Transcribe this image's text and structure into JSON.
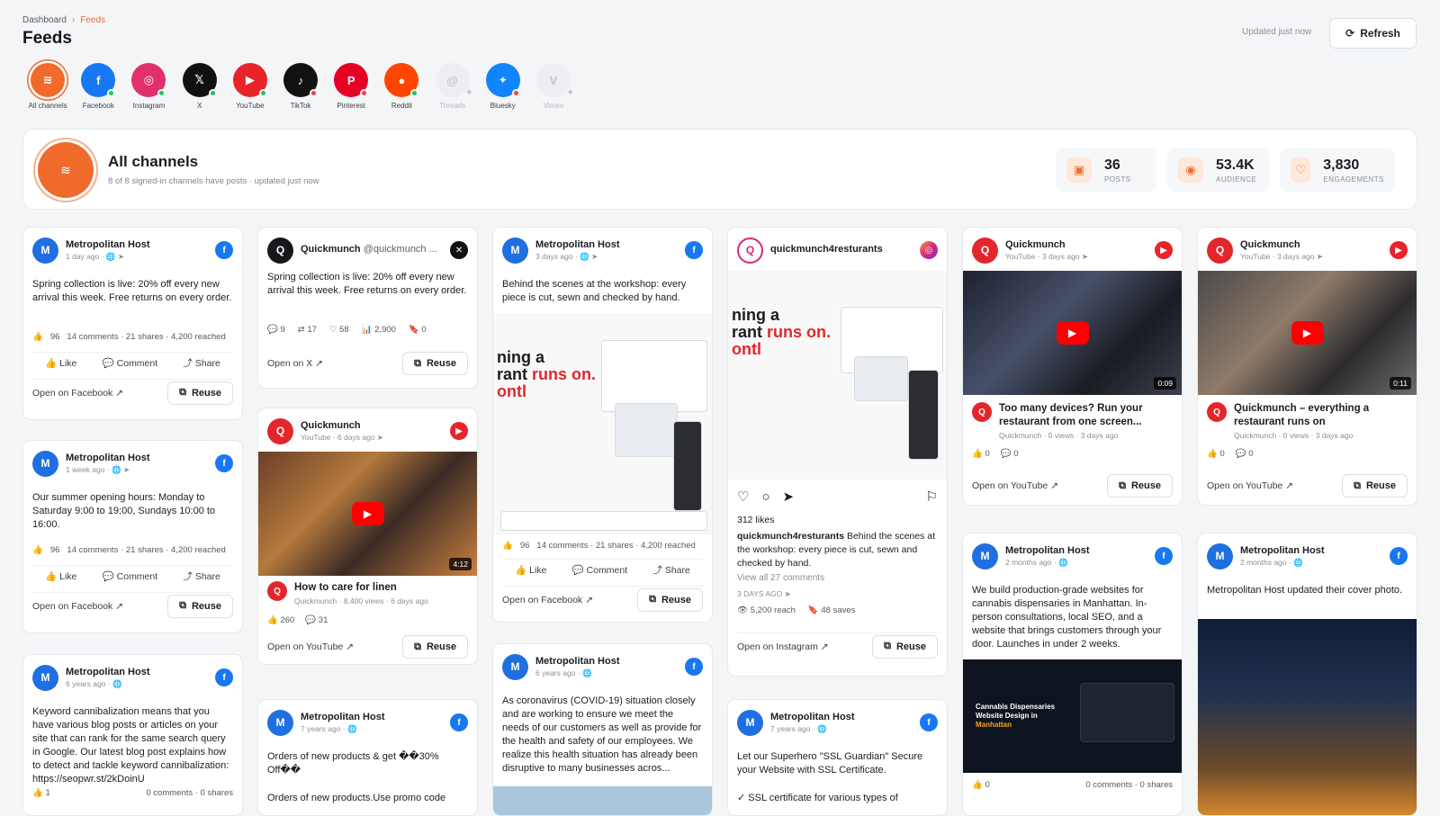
{
  "breadcrumb": {
    "root": "Dashboard",
    "current": "Feeds"
  },
  "page_title": "Feeds",
  "updated_text": "Updated just now",
  "refresh_label": "Refresh",
  "colors": {
    "accent": "#ef6c2d",
    "facebook": "#1877f2",
    "youtube": "#e8232a"
  },
  "channels": [
    {
      "label": "All channels",
      "icon": "layers-icon"
    },
    {
      "label": "Facebook",
      "icon": "facebook-icon",
      "glyph": "f"
    },
    {
      "label": "Instagram",
      "icon": "instagram-icon",
      "glyph": "◎"
    },
    {
      "label": "X",
      "icon": "x-icon",
      "glyph": "𝕏"
    },
    {
      "label": "YouTube",
      "icon": "youtube-icon",
      "glyph": "▶"
    },
    {
      "label": "TikTok",
      "icon": "tiktok-icon",
      "glyph": "♪"
    },
    {
      "label": "Pinterest",
      "icon": "pinterest-icon",
      "glyph": "P"
    },
    {
      "label": "Reddit",
      "icon": "reddit-icon",
      "glyph": "●"
    },
    {
      "label": "Threads",
      "icon": "threads-icon",
      "glyph": "@"
    },
    {
      "label": "Bluesky",
      "icon": "bluesky-icon",
      "glyph": "🦋"
    },
    {
      "label": "Vimeo",
      "icon": "vimeo-icon",
      "glyph": "V"
    }
  ],
  "banner": {
    "title": "All channels",
    "subtitle": "8 of 8 signed-in channels have posts",
    "updated": "· updated just now",
    "stats": [
      {
        "value": "36",
        "caption": "POSTS",
        "icon": "image-icon"
      },
      {
        "value": "53.4K",
        "caption": "AUDIENCE",
        "icon": "eye-icon"
      },
      {
        "value": "3,830",
        "caption": "ENGAGEMENTS",
        "icon": "heart-icon"
      }
    ]
  },
  "common": {
    "like": "Like",
    "comment": "Comment",
    "share": "Share",
    "reuse": "Reuse",
    "open_facebook": "Open on Facebook",
    "open_x": "Open on X",
    "open_youtube": "Open on YouTube",
    "open_instagram": "Open on Instagram"
  },
  "posts": {
    "c1a": {
      "name": "Metropolitan Host",
      "time": "1 day ago ·",
      "text": "Spring collection is live: 20% off every new arrival this week. Free returns on every order.",
      "likes": "96",
      "summary": "14 comments · 21 shares · 4,200 reached"
    },
    "c1b": {
      "name": "Metropolitan Host",
      "time": "1 week ago ·",
      "text": "Our summer opening hours: Monday to Saturday 9:00 to 19:00, Sundays 10:00 to 16:00.",
      "likes": "96",
      "summary": "14 comments · 21 shares · 4,200 reached"
    },
    "c1c": {
      "name": "Metropolitan Host",
      "time": "6 years ago ·",
      "text": "Keyword cannibalization means that you have various blog posts or articles on your site that can rank for the same search query in Google. Our latest blog post explains how to detect and tackle keyword cannibalization: https://seopwr.st/2kDoinU",
      "likes": "1",
      "summary": "0 comments · 0 shares"
    },
    "c2a": {
      "name": "Quickmunch",
      "handle": "@quickmunch ...",
      "text": "Spring collection is live: 20% off every new arrival this week. Free returns on every order.",
      "replies": "9",
      "reposts": "17",
      "likes": "58",
      "views": "2,900",
      "bookmarks": "0"
    },
    "c2b": {
      "name": "Quickmunch",
      "time": "YouTube · 6 days ago",
      "duration": "4:12",
      "title": "How to care for linen",
      "meta": "Quickmunch · 8,400 views · 6 days ago",
      "likes": "260",
      "comments": "31"
    },
    "c2c": {
      "name": "Metropolitan Host",
      "time": "7 years ago ·",
      "text": "Orders of new products & get ��30% Off��",
      "text2": "Orders of new products.Use promo code"
    },
    "c3a": {
      "name": "Metropolitan Host",
      "time": "3 days ago ·",
      "text": "Behind the scenes at the workshop: every piece is cut, sewn and checked by hand.",
      "likes": "96",
      "summary": "14 comments · 21 shares · 4,200 reached",
      "promo_line1": "ning a",
      "promo_line2": "rant ",
      "promo_hl": "runs on.",
      "promo_line3": "ontl"
    },
    "c3b": {
      "name": "Metropolitan Host",
      "time": "6 years ago ·",
      "text": "As coronavirus (COVID-19) situation closely and are working to ensure we meet the needs of our customers as well as provide for the health and safety of our employees. We realize this health situation has already been disruptive to many businesses acros..."
    },
    "c4a": {
      "name": "quickmunch4resturants",
      "likes_text": "312 likes",
      "caption_user": "quickmunch4resturants",
      "caption": " Behind the scenes at the workshop: every piece is cut, sewn and checked by hand.",
      "view_comments": "View all 27 comments",
      "date": "3 DAYS AGO",
      "reach": "5,200 reach",
      "saves": "48 saves",
      "promo_line1": "ning a",
      "promo_line2": "rant ",
      "promo_hl": "runs on.",
      "promo_line3": "ontl"
    },
    "c4b": {
      "name": "Metropolitan Host",
      "time": "7 years ago ·",
      "text": "Let our Superhero \"SSL Guardian\" Secure your Website with SSL Certificate.",
      "text2": "✓ SSL certificate for various types of"
    },
    "c5a": {
      "name": "Quickmunch",
      "time": "YouTube · 3 days ago",
      "duration": "0:09",
      "title": "Too many devices? Run your restaurant from one screen...",
      "meta": "Quickmunch · 0 views · 3 days ago",
      "likes": "0",
      "comments": "0"
    },
    "c5b": {
      "name": "Metropolitan Host",
      "time": "2 months ago ·",
      "text": "We build production-grade websites for cannabis dispensaries in Manhattan. In-person consultations, local SEO, and a website that brings customers through your door. Launches in under 2 weeks.",
      "likes": "0",
      "summary": "0 comments · 0 shares",
      "img_title": "Cannabis Dispensaries Website Design in ",
      "img_hl": "Manhattan"
    },
    "c6a": {
      "name": "Quickmunch",
      "time": "YouTube · 3 days ago",
      "duration": "0:11",
      "title": "Quickmunch – everything a restaurant runs on",
      "meta": "Quickmunch · 0 views · 3 days ago",
      "likes": "0",
      "comments": "0"
    },
    "c6b": {
      "name": "Metropolitan Host",
      "time": "2 months ago ·",
      "text": "Metropolitan Host updated their cover photo."
    }
  }
}
